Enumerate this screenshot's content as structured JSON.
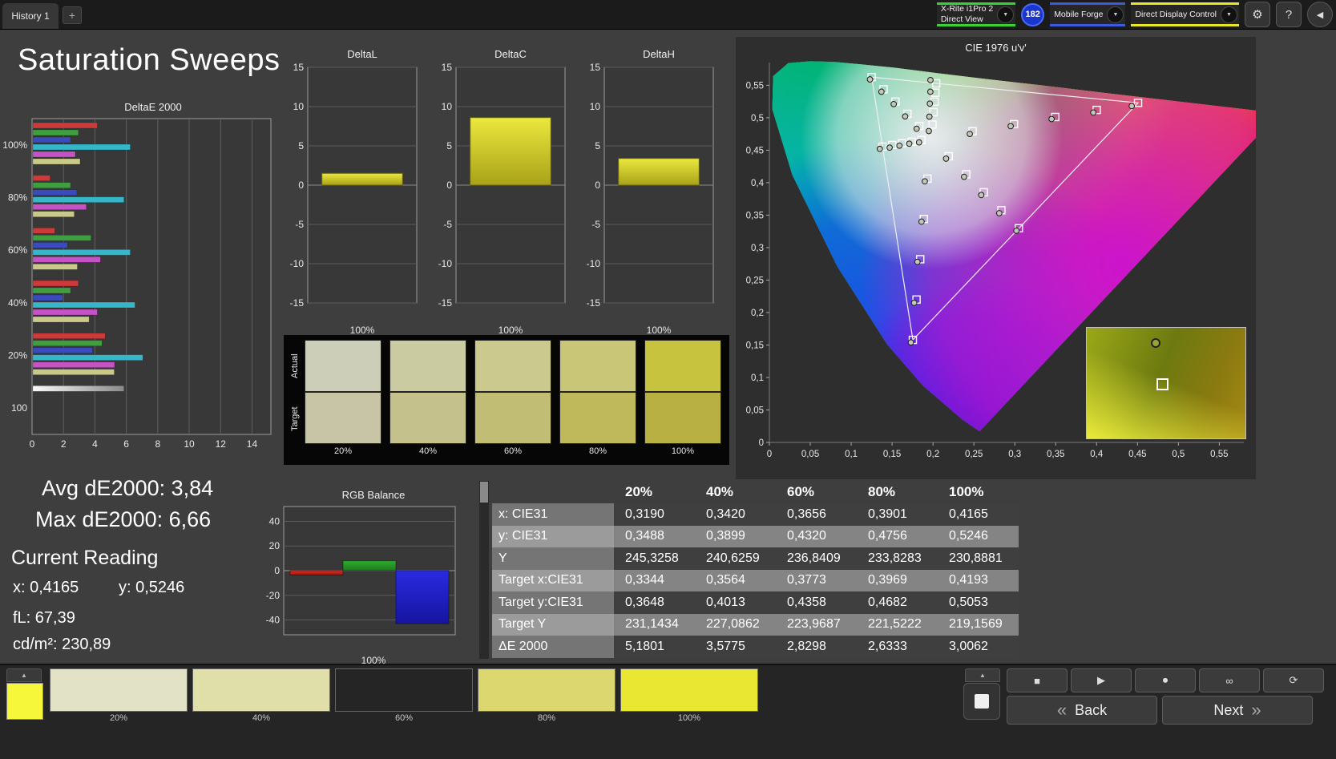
{
  "top_bar": {
    "tabs": [
      {
        "label": "History 1"
      }
    ],
    "add_tab_label": "+",
    "meter": {
      "line1": "X-Rite i1Pro 2",
      "line2": "Direct View",
      "accent": "#35d435",
      "dropdown_icon": "▼"
    },
    "reading_badge": "182",
    "reading_badge_color": "#1b35cf",
    "source": {
      "label": "Mobile Forge",
      "accent": "#3a5ae0",
      "dropdown_icon": "▼"
    },
    "display_control": {
      "label": "Direct Display Control",
      "accent": "#e8e829",
      "dropdown_icon": "▼"
    },
    "gear_icon": "⚙",
    "help_label": "?",
    "collapse_icon": "◀"
  },
  "page": {
    "title": "Saturation Sweeps"
  },
  "stats": {
    "avg": "Avg dE2000: 3,84",
    "max": "Max dE2000: 6,66",
    "current_reading": "Current Reading",
    "x": "x: 0,4165",
    "y": "y: 0,5246",
    "fl": "fL: 67,39",
    "cd": "cd/m²: 230,89"
  },
  "chart_data": [
    {
      "type": "bar",
      "orientation": "horizontal",
      "title": "DeltaE 2000",
      "categories": [
        "100%",
        "80%",
        "60%",
        "40%",
        "20%",
        "100"
      ],
      "series": [
        {
          "name": "red",
          "color": "#cc3a3a",
          "values": [
            4.1,
            1.1,
            1.4,
            2.9,
            4.6,
            null
          ]
        },
        {
          "name": "green",
          "color": "#3f9e3f",
          "values": [
            2.9,
            2.4,
            3.7,
            2.4,
            4.4,
            null
          ]
        },
        {
          "name": "blue",
          "color": "#3a4bbd",
          "values": [
            2.4,
            2.8,
            2.2,
            1.9,
            3.8,
            null
          ]
        },
        {
          "name": "cyan",
          "color": "#35b6c9",
          "values": [
            6.2,
            5.8,
            6.2,
            6.5,
            7.0,
            null
          ]
        },
        {
          "name": "magenta",
          "color": "#c653c6",
          "values": [
            2.7,
            3.4,
            4.3,
            4.1,
            5.2,
            null
          ]
        },
        {
          "name": "yellow",
          "color": "#c9c98a",
          "values": [
            3.0062,
            2.6333,
            2.8298,
            3.5775,
            5.1801,
            null
          ]
        },
        {
          "name": "white",
          "color": "gradient-white",
          "values": [
            null,
            null,
            null,
            null,
            null,
            5.8
          ]
        }
      ],
      "xlim": [
        0,
        15.2
      ],
      "xticks": [
        0,
        2,
        4,
        6,
        8,
        10,
        12,
        14
      ]
    },
    {
      "type": "bar",
      "title": "DeltaL",
      "categories": [
        "100%"
      ],
      "values": [
        1.5
      ],
      "ylim": [
        -15,
        15
      ],
      "yticks": [
        15,
        10,
        5,
        0,
        -5,
        -10,
        -15
      ],
      "color": "#d6d22a",
      "xlabel": "100%"
    },
    {
      "type": "bar",
      "title": "DeltaC",
      "categories": [
        "100%"
      ],
      "values": [
        8.6
      ],
      "ylim": [
        -15,
        15
      ],
      "yticks": [
        15,
        10,
        5,
        0,
        -5,
        -10,
        -15
      ],
      "color": "#d6d22a",
      "xlabel": "100%"
    },
    {
      "type": "bar",
      "title": "DeltaH",
      "categories": [
        "100%"
      ],
      "values": [
        3.4
      ],
      "ylim": [
        -15,
        15
      ],
      "yticks": [
        15,
        10,
        5,
        0,
        -5,
        -10,
        -15
      ],
      "color": "#d6d22a",
      "xlabel": "100%"
    },
    {
      "type": "bar",
      "title": "RGB Balance",
      "categories": [
        "Red",
        "Green",
        "Blue"
      ],
      "values": [
        -3.5,
        8,
        -43
      ],
      "colors": [
        "#d93025",
        "#2fae2f",
        "#2a2ae0"
      ],
      "ylim": [
        -52,
        52
      ],
      "yticks": [
        40,
        20,
        0,
        -20,
        -40
      ],
      "xlabel": "100%"
    },
    {
      "type": "scatter",
      "title": "CIE 1976 u'v'",
      "xlim": [
        0,
        0.58
      ],
      "ylim": [
        0,
        0.585
      ],
      "tick_step": 0.05,
      "tick_labels": [
        "0",
        "0,05",
        "0,1",
        "0,15",
        "0,2",
        "0,25",
        "0,3",
        "0,35",
        "0,4",
        "0,45",
        "0,5",
        "0,55"
      ],
      "gamut_triangle": [
        [
          0.4507,
          0.5229
        ],
        [
          0.125,
          0.5625
        ],
        [
          0.1754,
          0.1579
        ]
      ],
      "targets": {
        "red": [
          [
            0.2484,
            0.4792
          ],
          [
            0.299,
            0.4901
          ],
          [
            0.3495,
            0.5011
          ],
          [
            0.4001,
            0.512
          ],
          [
            0.4507,
            0.5229
          ]
        ],
        "green": [
          [
            0.1832,
            0.4871
          ],
          [
            0.1687,
            0.506
          ],
          [
            0.1541,
            0.5248
          ],
          [
            0.1396,
            0.5437
          ],
          [
            0.125,
            0.5625
          ]
        ],
        "blue": [
          [
            0.1933,
            0.4062
          ],
          [
            0.1888,
            0.3441
          ],
          [
            0.1844,
            0.2821
          ],
          [
            0.1799,
            0.22
          ],
          [
            0.1754,
            0.1579
          ]
        ],
        "cyan": [
          [
            0.1859,
            0.4657
          ],
          [
            0.174,
            0.4631
          ],
          [
            0.1621,
            0.4606
          ],
          [
            0.1502,
            0.458
          ],
          [
            0.1383,
            0.4554
          ]
        ],
        "magenta": [
          [
            0.2192,
            0.4406
          ],
          [
            0.2407,
            0.4129
          ],
          [
            0.2621,
            0.3852
          ],
          [
            0.2836,
            0.3575
          ],
          [
            0.305,
            0.3298
          ]
        ],
        "yellow": [
          [
            0.1994,
            0.4894
          ],
          [
            0.2007,
            0.5085
          ],
          [
            0.2019,
            0.5247
          ],
          [
            0.2029,
            0.5385
          ],
          [
            0.2039,
            0.5529
          ]
        ]
      },
      "measurements": {
        "red": [
          [
            0.245,
            0.475
          ],
          [
            0.295,
            0.487
          ],
          [
            0.345,
            0.498
          ],
          [
            0.396,
            0.508
          ],
          [
            0.443,
            0.518
          ]
        ],
        "green": [
          [
            0.18,
            0.483
          ],
          [
            0.166,
            0.502
          ],
          [
            0.152,
            0.521
          ],
          [
            0.137,
            0.54
          ],
          [
            0.123,
            0.559
          ]
        ],
        "blue": [
          [
            0.19,
            0.402
          ],
          [
            0.186,
            0.34
          ],
          [
            0.181,
            0.278
          ],
          [
            0.177,
            0.215
          ],
          [
            0.173,
            0.154
          ]
        ],
        "cyan": [
          [
            0.183,
            0.462
          ],
          [
            0.171,
            0.46
          ],
          [
            0.159,
            0.457
          ],
          [
            0.147,
            0.454
          ],
          [
            0.135,
            0.452
          ]
        ],
        "magenta": [
          [
            0.216,
            0.437
          ],
          [
            0.238,
            0.409
          ],
          [
            0.259,
            0.381
          ],
          [
            0.281,
            0.353
          ],
          [
            0.302,
            0.326
          ]
        ],
        "yellow": [
          [
            0.1949,
            0.4795
          ],
          [
            0.1956,
            0.5017
          ],
          [
            0.1962,
            0.5217
          ],
          [
            0.1968,
            0.54
          ],
          [
            0.1969,
            0.558
          ]
        ]
      },
      "inset": {
        "square": [
          0.47,
          0.5
        ],
        "dot": [
          0.43,
          0.13
        ]
      }
    }
  ],
  "swatch_strip": {
    "row_labels": [
      "Actual",
      "Target"
    ],
    "columns": [
      {
        "label": "20%",
        "actual": "#ccceb8",
        "target": "#c8c5a6"
      },
      {
        "label": "40%",
        "actual": "#cbcba1",
        "target": "#c5c18c"
      },
      {
        "label": "60%",
        "actual": "#cbc98e",
        "target": "#c2bd74"
      },
      {
        "label": "80%",
        "actual": "#c9c677",
        "target": "#c0b95c"
      },
      {
        "label": "100%",
        "actual": "#c7c33e",
        "target": "#b9b043"
      }
    ]
  },
  "table": {
    "headers": [
      "",
      "20%",
      "40%",
      "60%",
      "80%",
      "100%"
    ],
    "rows": [
      {
        "label": "x: CIE31",
        "values": [
          "0,3190",
          "0,3420",
          "0,3656",
          "0,3901",
          "0,4165"
        ]
      },
      {
        "label": "y: CIE31",
        "values": [
          "0,3488",
          "0,3899",
          "0,4320",
          "0,4756",
          "0,5246"
        ]
      },
      {
        "label": "Y",
        "values": [
          "245,3258",
          "240,6259",
          "236,8409",
          "233,8283",
          "230,8881"
        ]
      },
      {
        "label": "Target x:CIE31",
        "values": [
          "0,3344",
          "0,3564",
          "0,3773",
          "0,3969",
          "0,4193"
        ]
      },
      {
        "label": "Target y:CIE31",
        "values": [
          "0,3648",
          "0,4013",
          "0,4358",
          "0,4682",
          "0,5053"
        ]
      },
      {
        "label": "Target Y",
        "values": [
          "231,1434",
          "227,0862",
          "223,9687",
          "221,5222",
          "219,1569"
        ]
      },
      {
        "label": "ΔE 2000",
        "values": [
          "5,1801",
          "3,5775",
          "2,8298",
          "2,6333",
          "3,0062"
        ]
      }
    ]
  },
  "bottom_bar": {
    "eject_icon": "▲",
    "current_patch_color": "#f6f63a",
    "patches": [
      {
        "label": "20%",
        "color": "#e2e3c6"
      },
      {
        "label": "40%",
        "color": "#e0dea9"
      },
      {
        "label": "60%",
        "color": "#dedа8e"
      },
      {
        "label": "80%",
        "color": "#dcd76f"
      },
      {
        "label": "100%",
        "color": "#eae733"
      }
    ],
    "transport": [
      {
        "name": "stop",
        "icon": "■"
      },
      {
        "name": "play",
        "icon": "▶"
      },
      {
        "name": "record",
        "icon": "⏺"
      },
      {
        "name": "continuous",
        "icon": "∞"
      },
      {
        "name": "refresh",
        "icon": "⟳"
      }
    ],
    "back": {
      "label": "Back",
      "icon": "«"
    },
    "next": {
      "label": "Next",
      "icon": "»"
    }
  }
}
